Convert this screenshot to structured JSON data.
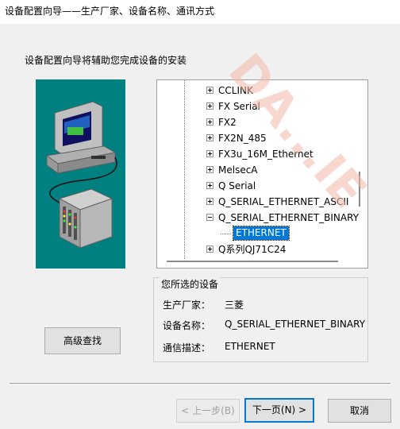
{
  "window": {
    "title": "设备配置向导——生产厂家、设备名称、通讯方式"
  },
  "subtitle": "设备配置向导将辅助您完成设备的安装",
  "tree": {
    "items": [
      {
        "label": "CCLINK",
        "expander": "plus"
      },
      {
        "label": "FX Serial",
        "expander": "plus"
      },
      {
        "label": "FX2",
        "expander": "plus"
      },
      {
        "label": "FX2N_485",
        "expander": "plus"
      },
      {
        "label": "FX3u_16M_Ethernet",
        "expander": "plus"
      },
      {
        "label": "MelsecA",
        "expander": "plus"
      },
      {
        "label": "Q Serial",
        "expander": "plus"
      },
      {
        "label": "Q_SERIAL_ETHERNET_ASCII",
        "expander": "plus"
      },
      {
        "label": "Q_SERIAL_ETHERNET_BINARY",
        "expander": "minus"
      },
      {
        "label": "ETHERNET",
        "selected": true
      },
      {
        "label": "Q系列QJ71C24",
        "expander": "plus"
      }
    ]
  },
  "selected_device": {
    "title": "您所选的设备",
    "manufacturer_label": "生产厂家：",
    "manufacturer_value": "三菱",
    "device_label": "设备名称：",
    "device_value": "Q_SERIAL_ETHERNET_BINARY",
    "comm_label": "通信描述：",
    "comm_value": "ETHERNET"
  },
  "buttons": {
    "advanced": "高级查找",
    "back": "< 上一步(B)",
    "next": "下一页(N) >",
    "cancel": "取消"
  },
  "watermark": "DA...IE",
  "colors": {
    "illustration_bg": "#008080",
    "selection": "#0078d7",
    "default_button_border": "#0078d7"
  }
}
